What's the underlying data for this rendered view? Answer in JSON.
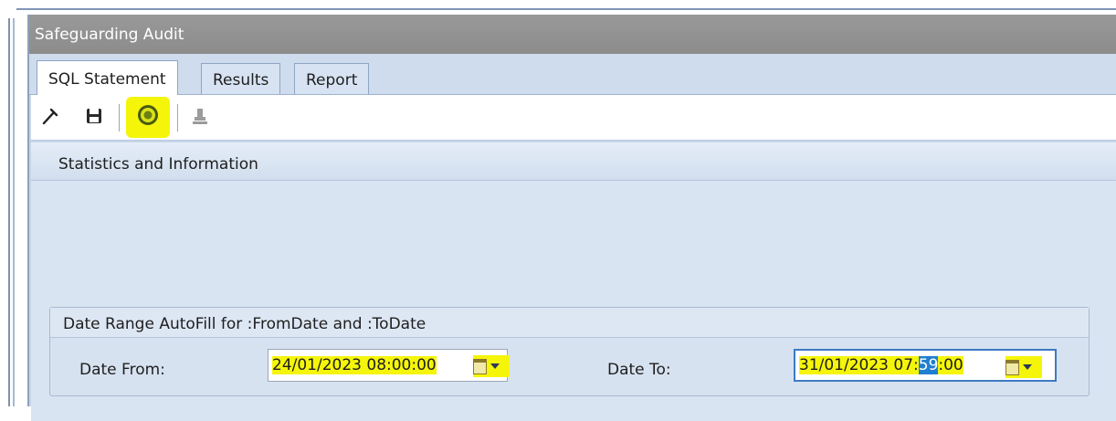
{
  "window": {
    "title": "Safeguarding Audit"
  },
  "tabs": [
    {
      "label": "SQL Statement",
      "active": true
    },
    {
      "label": "Results",
      "active": false
    },
    {
      "label": "Report",
      "active": false
    }
  ],
  "toolbar": {
    "buttons": [
      {
        "icon": "hammer-icon"
      },
      {
        "icon": "save-icon"
      },
      {
        "icon": "run-icon",
        "highlighted": true
      },
      {
        "icon": "export-icon",
        "disabled": true
      }
    ]
  },
  "section": {
    "title": "Statistics and Information"
  },
  "date_range": {
    "title": "Date Range AutoFill for :FromDate and :ToDate",
    "from_label": "Date From:",
    "from_value": "24/01/2023 08:00:00",
    "to_label": "Date To:",
    "to_value_prefix": "31/01/2023 07:",
    "to_value_selected": "59",
    "to_value_suffix": ":00"
  },
  "colors": {
    "highlight": "#f5f50a",
    "selection": "#1f7fd1",
    "titlebar": "#999999",
    "panel": "#d9e4f2"
  }
}
